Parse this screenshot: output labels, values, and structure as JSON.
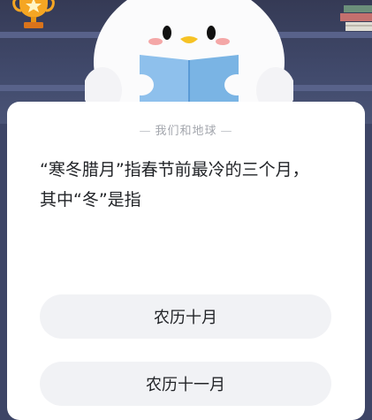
{
  "quiz": {
    "category": "我们和地球",
    "question": "“寒冬腊月”指春节前最冷的三个月，其中“冬”是指",
    "options": [
      {
        "label": "农历十月"
      },
      {
        "label": "农历十一月"
      }
    ]
  },
  "icons": {
    "header_left": "trophy-icon",
    "header_right": "books-icon",
    "mascot": "penguin-mascot-reading-book"
  },
  "colors": {
    "background": "#3d4566",
    "card": "#ffffff",
    "option_bg": "#f1f2f5",
    "text": "#222428",
    "subtitle": "#a3a6ad",
    "trophy": "#f5a623",
    "book": "#7fb6e6"
  }
}
